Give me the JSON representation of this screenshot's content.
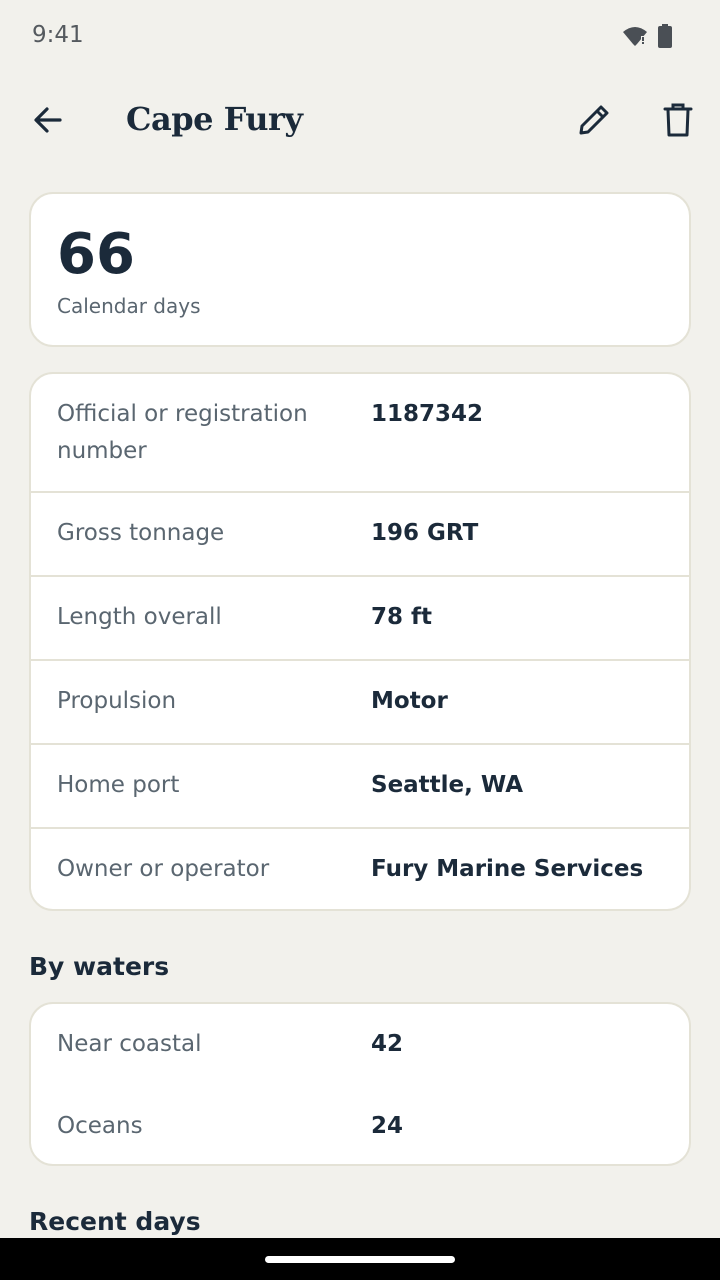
{
  "status_bar": {
    "time": "9:41",
    "icons": [
      "wifi-icon",
      "battery-icon"
    ]
  },
  "app_bar": {
    "title": "Cape Fury",
    "actions": [
      "edit-icon",
      "delete-icon"
    ]
  },
  "summary": {
    "value": "66",
    "label": "Calendar days"
  },
  "details": [
    {
      "label": "Official or registration number",
      "value": "1187342"
    },
    {
      "label": "Gross tonnage",
      "value": "196 GRT"
    },
    {
      "label": "Length overall",
      "value": "78 ft"
    },
    {
      "label": "Propulsion",
      "value": "Motor"
    },
    {
      "label": "Home port",
      "value": "Seattle, WA"
    },
    {
      "label": "Owner or operator",
      "value": "Fury Marine Services"
    }
  ],
  "by_waters": {
    "heading": "By waters",
    "rows": [
      {
        "label": "Near coastal",
        "value": "42"
      },
      {
        "label": "Oceans",
        "value": "24"
      }
    ]
  },
  "recent_days": {
    "heading": "Recent days"
  },
  "colors": {
    "background": "#f2f1ec",
    "card": "#ffffff",
    "border": "#e4e2d6",
    "text_primary": "#1b2a3a",
    "text_secondary": "#5a6670"
  }
}
